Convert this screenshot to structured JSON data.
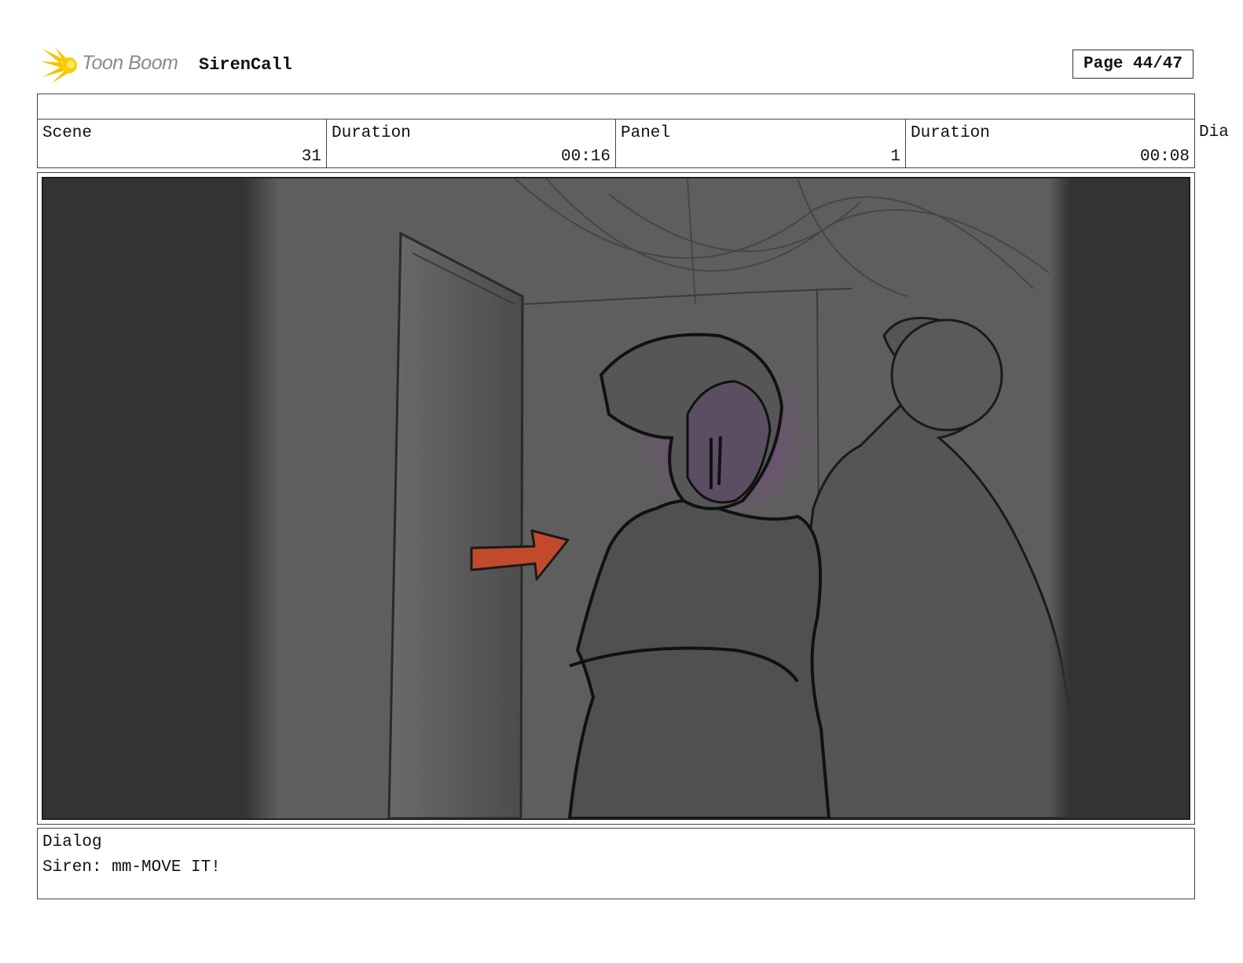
{
  "header": {
    "logo_text": "Toon Boom",
    "project_name": "SirenCall",
    "page_label": "Page 44/47"
  },
  "info": {
    "scene_label": "Scene",
    "scene_value": "31",
    "scene_duration_label": "Duration",
    "scene_duration_value": "00:16",
    "panel_label": "Panel",
    "panel_value": "1",
    "panel_duration_label": "Duration",
    "panel_duration_value": "00:08",
    "overflow_label": "Dia"
  },
  "dialog": {
    "label": "Dialog",
    "text": "Siren: mm-MOVE IT!"
  },
  "colors": {
    "panel_bg": "#5e5e5e",
    "letterbox": "#333333",
    "arrow": "#c24a2c",
    "glow": "#8a3a9a",
    "logo_yellow": "#f5c400"
  }
}
